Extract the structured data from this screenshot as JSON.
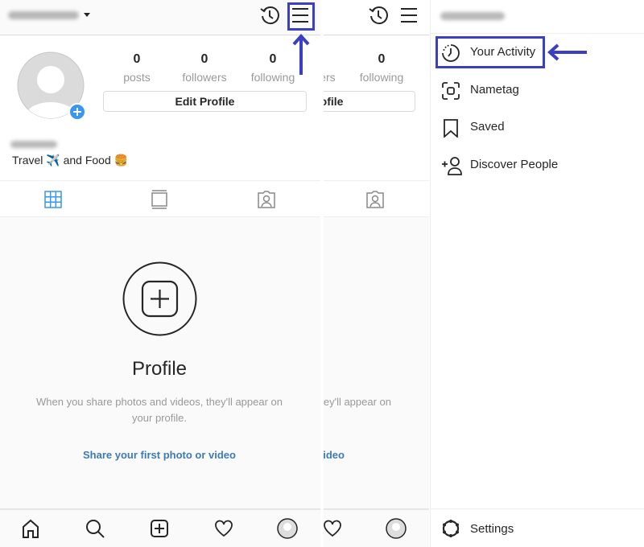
{
  "profile": {
    "stats": [
      {
        "value": "0",
        "label": "posts"
      },
      {
        "value": "0",
        "label": "followers"
      },
      {
        "value": "0",
        "label": "following"
      }
    ],
    "edit_profile": "Edit Profile",
    "bio": "Travel ✈️ and Food 🍔",
    "empty_title": "Profile",
    "empty_line1": "When you share photos and videos, they'll appear on",
    "empty_line2": "your profile.",
    "share_link": "Share your first photo or video"
  },
  "drawer": {
    "items": [
      {
        "label": "Your Activity",
        "icon": "activity-icon"
      },
      {
        "label": "Nametag",
        "icon": "nametag-icon"
      },
      {
        "label": "Saved",
        "icon": "bookmark-icon"
      },
      {
        "label": "Discover People",
        "icon": "add-person-icon"
      }
    ],
    "settings": "Settings"
  },
  "colors": {
    "accent": "#3897f0",
    "link": "#3d7ab8",
    "annotation": "#3a3fc4"
  }
}
